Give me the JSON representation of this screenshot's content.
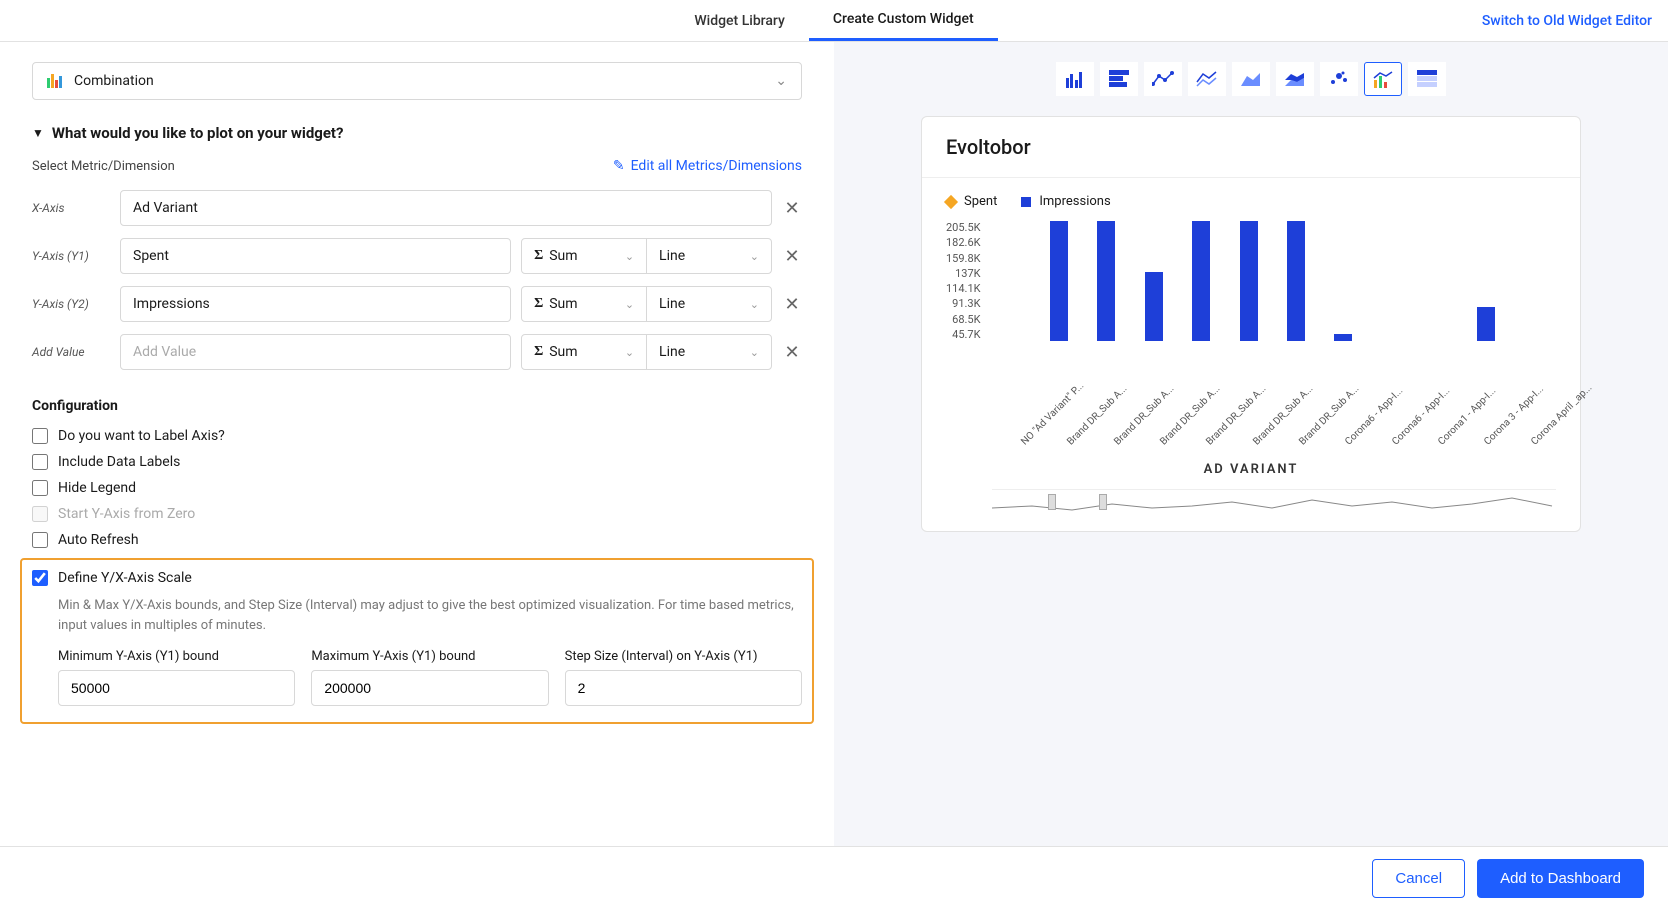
{
  "header": {
    "tabs": [
      "Widget Library",
      "Create Custom Widget"
    ],
    "active_tab": 1,
    "switch_link": "Switch to Old Widget Editor"
  },
  "chart_type_selector": "Combination",
  "plot_section": {
    "title": "What would you like to plot on your widget?",
    "select_label": "Select Metric/Dimension",
    "edit_link": "Edit all Metrics/Dimensions",
    "rows": [
      {
        "label": "X-Axis",
        "value": "Ad Variant",
        "agg": null,
        "render": null
      },
      {
        "label": "Y-Axis (Y1)",
        "value": "Spent",
        "agg": "Sum",
        "render": "Line"
      },
      {
        "label": "Y-Axis (Y2)",
        "value": "Impressions",
        "agg": "Sum",
        "render": "Line"
      },
      {
        "label": "Add Value",
        "value": "",
        "placeholder": "Add Value",
        "agg": "Sum",
        "render": "Line"
      }
    ]
  },
  "configuration": {
    "title": "Configuration",
    "options": [
      {
        "label": "Do you want to Label Axis?",
        "checked": false,
        "disabled": false
      },
      {
        "label": "Include Data Labels",
        "checked": false,
        "disabled": false
      },
      {
        "label": "Hide Legend",
        "checked": false,
        "disabled": false
      },
      {
        "label": "Start Y-Axis from Zero",
        "checked": false,
        "disabled": true
      },
      {
        "label": "Auto Refresh",
        "checked": false,
        "disabled": false
      },
      {
        "label": "Define Y/X-Axis Scale",
        "checked": true,
        "disabled": false
      }
    ],
    "scale_desc": "Min & Max Y/X-Axis bounds, and Step Size (Interval) may adjust to give the best optimized visualization. For time based metrics, input values in multiples of minutes.",
    "scale_inputs": [
      {
        "label": "Minimum Y-Axis (Y1) bound",
        "value": "50000"
      },
      {
        "label": "Maximum Y-Axis (Y1) bound",
        "value": "200000"
      },
      {
        "label": "Step Size (Interval) on Y-Axis (Y1)",
        "value": "2"
      }
    ]
  },
  "preview": {
    "chart_icons": [
      "bar",
      "stacked-bar",
      "line",
      "multi-line",
      "area",
      "stacked-area",
      "scatter",
      "combo",
      "table"
    ],
    "active_icon": 7,
    "title": "Evoltobor",
    "legend": [
      {
        "name": "Spent",
        "shape": "diamond",
        "color": "#f5a623"
      },
      {
        "name": "Impressions",
        "shape": "square",
        "color": "#1e3fd8"
      }
    ],
    "axis_title": "AD VARIANT"
  },
  "chart_data": {
    "type": "bar",
    "title": "Evoltobor",
    "xlabel": "AD VARIANT",
    "ylabel": "",
    "y_ticks": [
      "205.5K",
      "182.6K",
      "159.8K",
      "137K",
      "114.1K",
      "91.3K",
      "68.5K",
      "45.7K"
    ],
    "ylim": [
      45700,
      205500
    ],
    "categories": [
      "NO \"Ad Variant\" P...",
      "Brand DR_Sub A...",
      "Brand DR_Sub A...",
      "Brand DR_Sub A...",
      "Brand DR_Sub A...",
      "Brand DR_Sub A...",
      "Brand DR_Sub A...",
      "Corona6 - App-I...",
      "Corona6 - App-I...",
      "Corona1 - App-I...",
      "Corona 3 - App-I...",
      "Corona April _ap..."
    ],
    "series": [
      {
        "name": "Impressions",
        "values": [
          0,
          205000,
          205000,
          137000,
          205000,
          205000,
          205000,
          55000,
          0,
          0,
          91000,
          0
        ]
      }
    ]
  },
  "footer": {
    "cancel": "Cancel",
    "add": "Add to Dashboard"
  }
}
